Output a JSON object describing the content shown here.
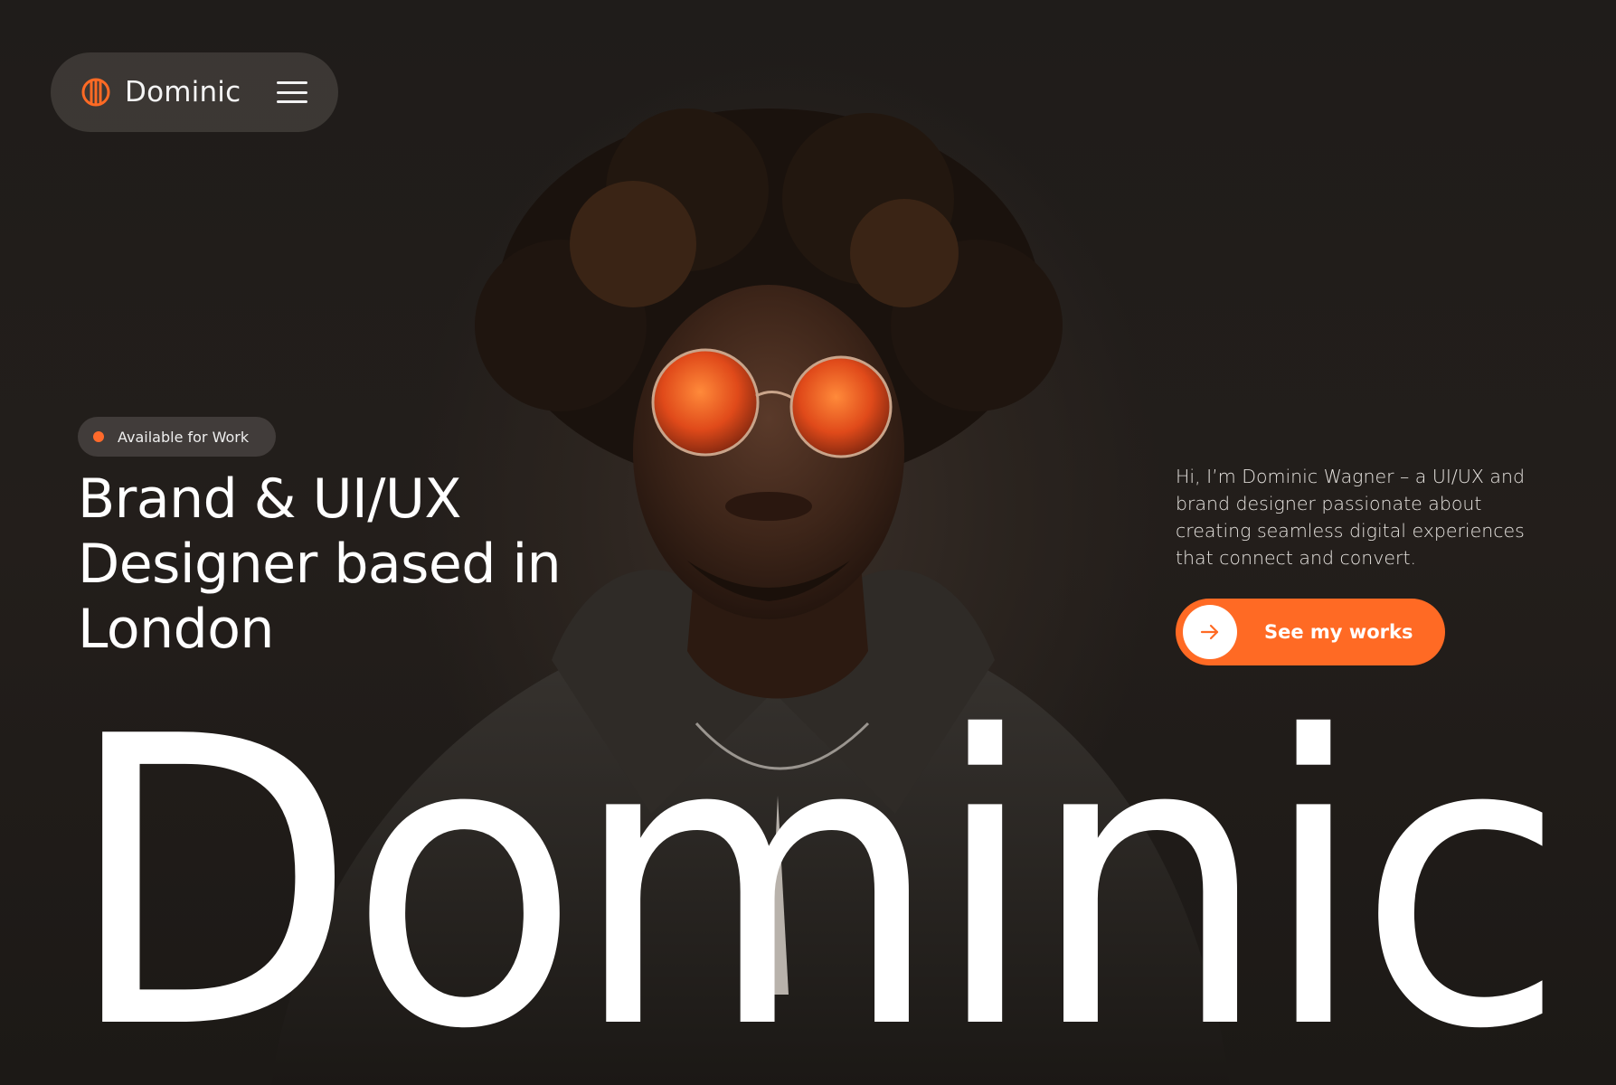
{
  "nav": {
    "brand_name": "Dominic",
    "logo_icon": "striped-circle-icon",
    "menu_icon": "hamburger-menu-icon"
  },
  "badge": {
    "label": "Available for Work",
    "dot_color": "#ff6a2b"
  },
  "hero": {
    "headline": "Brand & UI/UX Designer based in London",
    "intro": "Hi, I’m Dominic Wagner – a UI/UX and brand designer passionate about creating seamless digital experiences that connect and convert.",
    "cta_label": "See my works",
    "cta_icon": "arrow-right-icon",
    "wordmark": "Dominic"
  },
  "colors": {
    "accent": "#ff6a24",
    "background": "#1e1a17",
    "text": "#ffffff"
  }
}
